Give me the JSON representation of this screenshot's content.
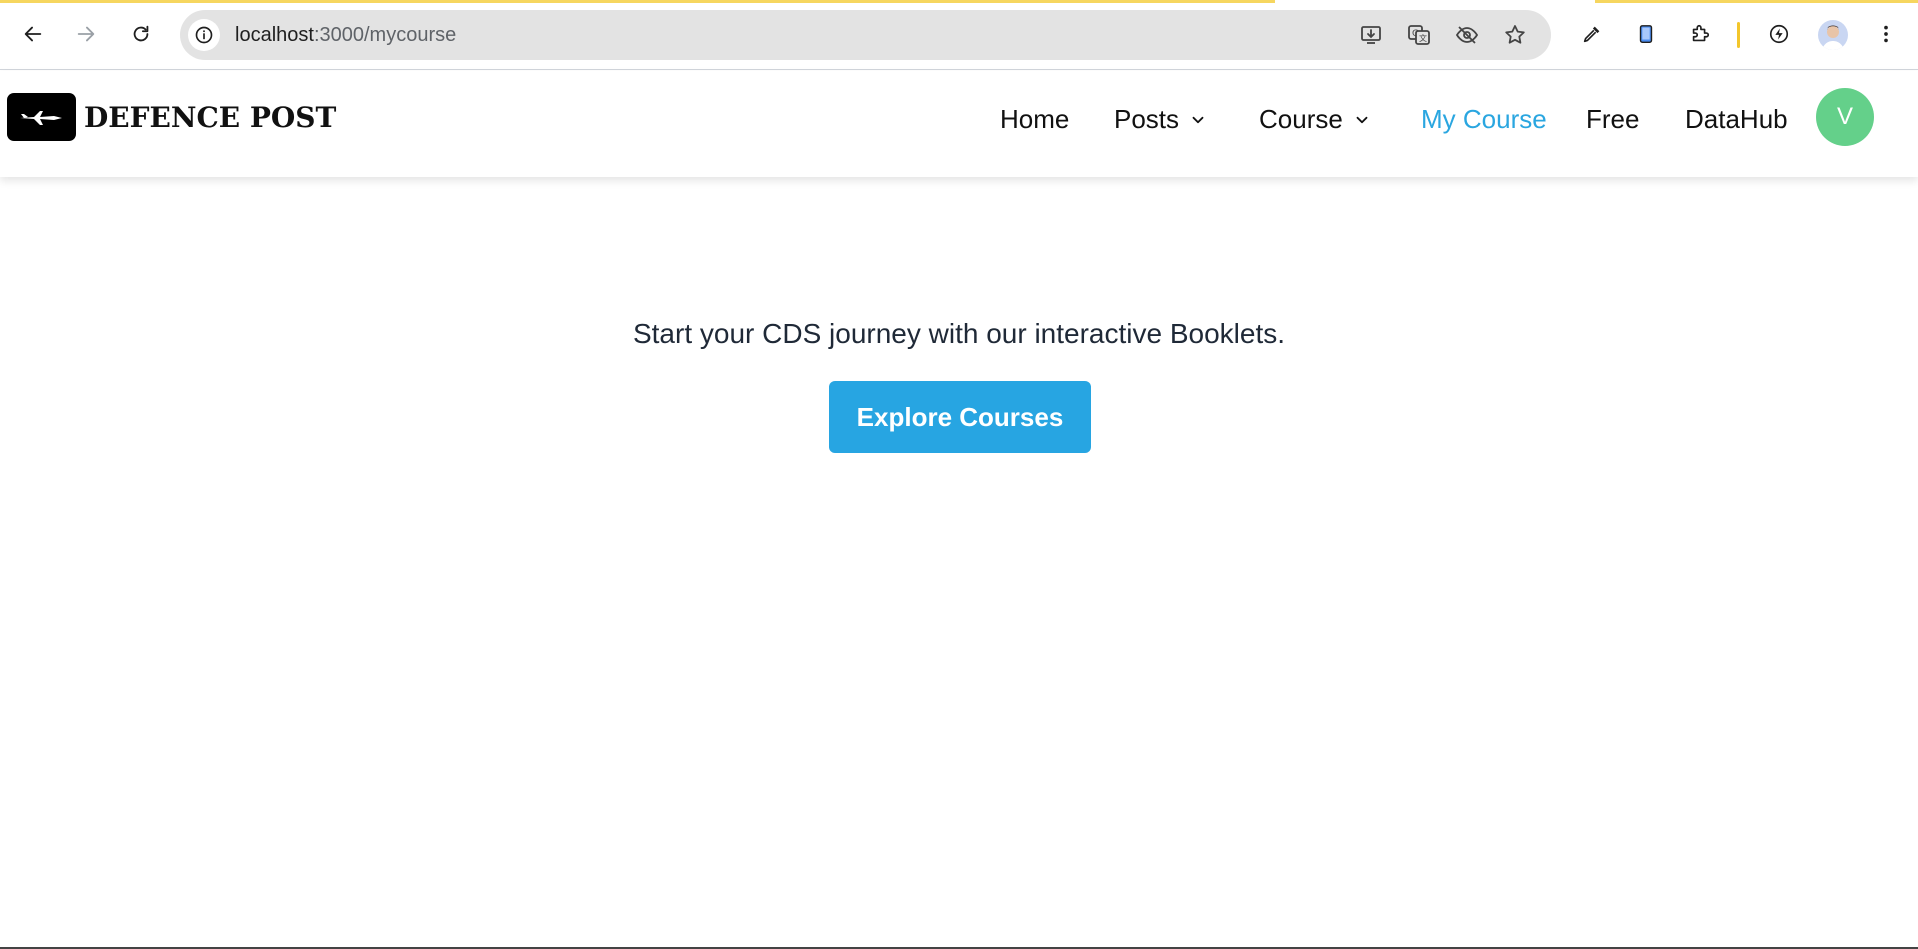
{
  "browser": {
    "url_host": "localhost",
    "url_path": ":3000/mycourse",
    "icons": {
      "back": "arrow-left-icon",
      "forward": "arrow-right-icon",
      "reload": "reload-icon",
      "site_info": "info-icon",
      "install": "install-app-icon",
      "translate": "translate-icon",
      "tracking": "eye-off-icon",
      "bookmark": "star-icon",
      "eyedropper": "eyedropper-icon",
      "device": "device-icon",
      "extensions": "puzzle-icon",
      "performance": "lightning-icon",
      "profile": "profile-icon",
      "menu": "kebab-menu-icon"
    }
  },
  "header": {
    "brand": "DEFENCE POST",
    "logo_icon": "fighter-jet-icon",
    "nav": [
      {
        "label": "Home",
        "has_dropdown": false,
        "active": false
      },
      {
        "label": "Posts",
        "has_dropdown": true,
        "active": false
      },
      {
        "label": "Course",
        "has_dropdown": true,
        "active": false
      },
      {
        "label": "My Course",
        "has_dropdown": false,
        "active": true
      },
      {
        "label": "Free",
        "has_dropdown": false,
        "active": false
      },
      {
        "label": "DataHub",
        "has_dropdown": false,
        "active": false
      }
    ],
    "avatar_initial": "V"
  },
  "main": {
    "headline": "Start your CDS journey with our interactive Booklets.",
    "cta_label": "Explore Courses"
  },
  "colors": {
    "accent": "#27a5e2",
    "active_nav": "#2aa6e0",
    "avatar_bg": "#64d08a",
    "loading_bar": "#f6d65f"
  }
}
